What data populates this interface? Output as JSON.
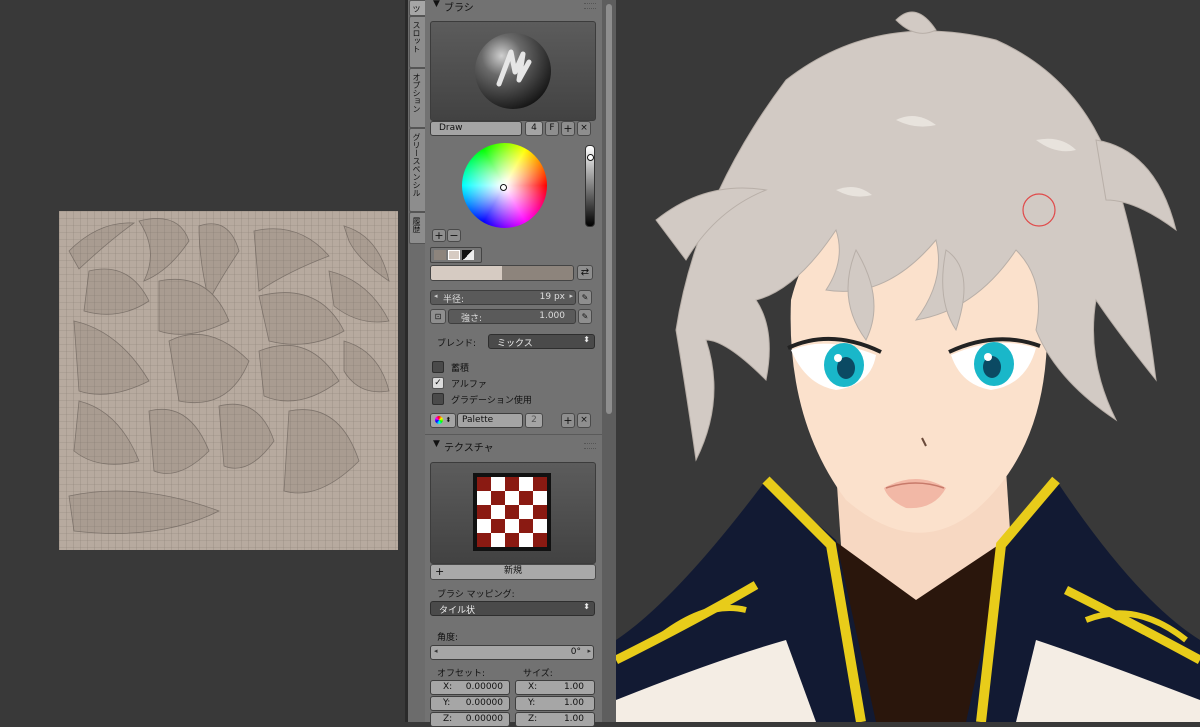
{
  "side_tabs": [
    "ツ",
    "スロット",
    "オプション",
    "グリースペンシル",
    "履歴"
  ],
  "brush_panel": {
    "header": "ブラシ",
    "brush_name": "Draw",
    "user_count": "4",
    "fake_user": "F",
    "add_symbol": "+",
    "remove_symbol": "×",
    "color_primary": "#d6cbc2",
    "color_secondary": "#8d847c",
    "radius_label": "半径:",
    "radius_value": "19 px",
    "strength_label": "強さ:",
    "strength_value": "1.000",
    "blend_label": "ブレンド:",
    "blend_value": "ミックス",
    "checkboxes": [
      {
        "label": "蓄積",
        "checked": false
      },
      {
        "label": "アルファ",
        "checked": true
      },
      {
        "label": "グラデーション使用",
        "checked": false
      }
    ],
    "palette_name": "Palette",
    "palette_users": "2"
  },
  "texture_panel": {
    "header": "テクスチャ",
    "new_label": "新規",
    "mapping_label": "ブラシ マッピング:",
    "mapping_value": "タイル状",
    "angle_label": "角度:",
    "angle_value": "0°",
    "offset_label": "オフセット:",
    "size_label": "サイズ:",
    "offset_x_label": "X:",
    "offset_x": "0.00000",
    "offset_y_label": "Y:",
    "offset_y": "0.00000",
    "offset_z_label": "Z:",
    "offset_z": "0.00000",
    "size_x_label": "X:",
    "size_x": "1.00",
    "size_y_label": "Y:",
    "size_y": "1.00",
    "size_z_label": "Z:",
    "size_z": "1.00"
  },
  "colors": {
    "hair": "#d2cac4",
    "eye": "#19b7c9",
    "skin": "#fbe1cc",
    "coat": "#121a33",
    "trim": "#e8cc1a"
  }
}
